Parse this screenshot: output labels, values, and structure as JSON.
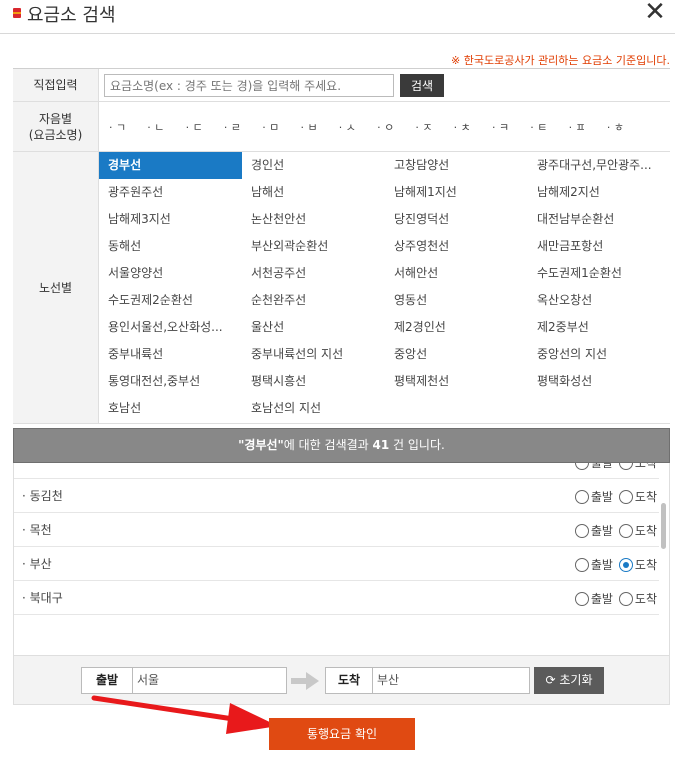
{
  "title": "요금소 검색",
  "notice": "※ 한국도로공사가 관리하는 요금소 기준입니다.",
  "direct": {
    "label": "직접입력",
    "placeholder": "요금소명(ex : 경주 또는 경)을 입력해 주세요.",
    "button": "검색"
  },
  "jamo": {
    "label_line1": "자음별",
    "label_line2": "(요금소명)",
    "items": [
      "ㄱ",
      "ㄴ",
      "ㄷ",
      "ㄹ",
      "ㅁ",
      "ㅂ",
      "ㅅ",
      "ㅇ",
      "ㅈ",
      "ㅊ",
      "ㅋ",
      "ㅌ",
      "ㅍ",
      "ㅎ"
    ]
  },
  "routes": {
    "label": "노선별",
    "items": [
      "경부선",
      "경인선",
      "고창담양선",
      "광주대구선,무안광주...",
      "광주원주선",
      "남해선",
      "남해제1지선",
      "남해제2지선",
      "남해제3지선",
      "논산천안선",
      "당진영덕선",
      "대전남부순환선",
      "동해선",
      "부산외곽순환선",
      "상주영천선",
      "새만금포항선",
      "서울양양선",
      "서천공주선",
      "서해안선",
      "수도권제1순환선",
      "수도권제2순환선",
      "순천완주선",
      "영동선",
      "옥산오창선",
      "용인서울선,오산화성...",
      "울산선",
      "제2경인선",
      "제2중부선",
      "중부내륙선",
      "중부내륙선의 지선",
      "중앙선",
      "중앙선의 지선",
      "통영대전선,중부선",
      "평택시흥선",
      "평택제천선",
      "평택화성선",
      "호남선",
      "호남선의 지선"
    ],
    "selected": "경부선"
  },
  "result": {
    "route": "\"경부선\"",
    "middle": "에 대한 검색결과 ",
    "count": "41",
    "suffix": " 건 입니다."
  },
  "tollgates": [
    {
      "name": "",
      "arrive_checked": false
    },
    {
      "name": "동김천",
      "arrive_checked": false
    },
    {
      "name": "목천",
      "arrive_checked": false
    },
    {
      "name": "부산",
      "arrive_checked": true
    },
    {
      "name": "북대구",
      "arrive_checked": false
    }
  ],
  "radio_labels": {
    "depart": "출발",
    "arrive": "도착"
  },
  "footer": {
    "depart_label": "출발",
    "depart_value": "서울",
    "arrive_label": "도착",
    "arrive_value": "부산",
    "reset": "초기화"
  },
  "confirm": "통행요금 확인"
}
